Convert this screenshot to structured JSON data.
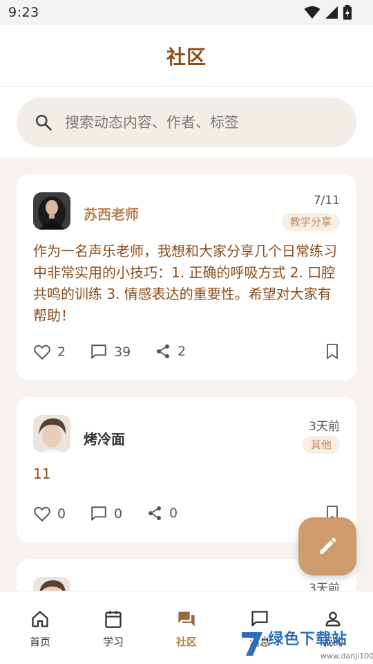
{
  "status_bar": {
    "time": "9:23"
  },
  "header": {
    "title": "社区"
  },
  "search": {
    "placeholder": "搜索动态内容、作者、标签"
  },
  "posts": [
    {
      "author": "苏西老师",
      "date": "7/11",
      "category": "教学分享",
      "content": "作为一名声乐老师，我想和大家分享几个日常练习中非常实用的小技巧：1. 正确的呼吸方式 2. 口腔共鸣的训练 3. 情感表达的重要性。希望对大家有帮助！",
      "likes": "2",
      "comments": "39",
      "shares": "2"
    },
    {
      "author": "烤冷面",
      "date": "3天前",
      "category": "其他",
      "content": "11",
      "likes": "0",
      "comments": "0",
      "shares": "0"
    },
    {
      "date": "3天前"
    }
  ],
  "bottom_nav": [
    {
      "label": "首页",
      "icon": "home-icon"
    },
    {
      "label": "学习",
      "icon": "calendar-icon"
    },
    {
      "label": "社区",
      "icon": "forum-icon",
      "active": true
    },
    {
      "label": "消息",
      "icon": "chat-icon"
    },
    {
      "label": "我的",
      "icon": "person-icon"
    }
  ],
  "watermark": {
    "text": "绿色下载站",
    "sub": "www.danji100.com"
  },
  "colors": {
    "accent": "#8a4d1c",
    "fab": "#d09b6c",
    "nav_active": "#b57e4c",
    "badge_bg": "#f8eee4"
  }
}
